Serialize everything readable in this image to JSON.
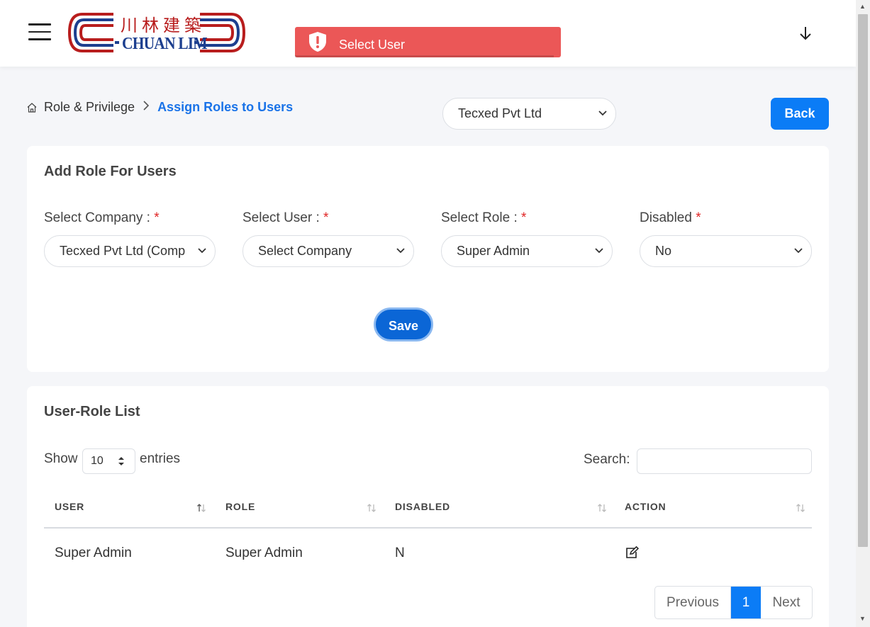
{
  "header": {
    "logo_english": "CHUAN LIM",
    "logo_chinese": "川林建築",
    "toast_message": "Select User"
  },
  "breadcrumb": {
    "parent": "Role & Privilege",
    "current": "Assign Roles to Users"
  },
  "top_company_select": {
    "value": "Tecxed Pvt Ltd"
  },
  "back_button": "Back",
  "add_role_card": {
    "title": "Add Role For Users",
    "fields": [
      {
        "label": "Select Company :",
        "value": "Tecxed Pvt Ltd (Comp"
      },
      {
        "label": "Select User :",
        "value": "Select Company"
      },
      {
        "label": "Select Role :",
        "value": "Super Admin"
      },
      {
        "label": "Disabled",
        "value": "No"
      }
    ],
    "required_marker": "*",
    "save_button": "Save"
  },
  "list_card": {
    "title": "User-Role List",
    "show_label": "Show",
    "page_length": "10",
    "entries_label": "entries",
    "search_label": "Search:",
    "search_value": "",
    "columns": [
      "USER",
      "ROLE",
      "DISABLED",
      "ACTION"
    ],
    "rows": [
      {
        "user": "Super Admin",
        "role": "Super Admin",
        "disabled": "N",
        "action": "edit-icon"
      }
    ],
    "pagination": {
      "previous": "Previous",
      "current_page": "1",
      "next": "Next"
    }
  },
  "colors": {
    "primary": "#0b7cf6",
    "toast": "#eb5757",
    "required": "#e02424",
    "breadcrumb_active": "#1a73e8"
  }
}
